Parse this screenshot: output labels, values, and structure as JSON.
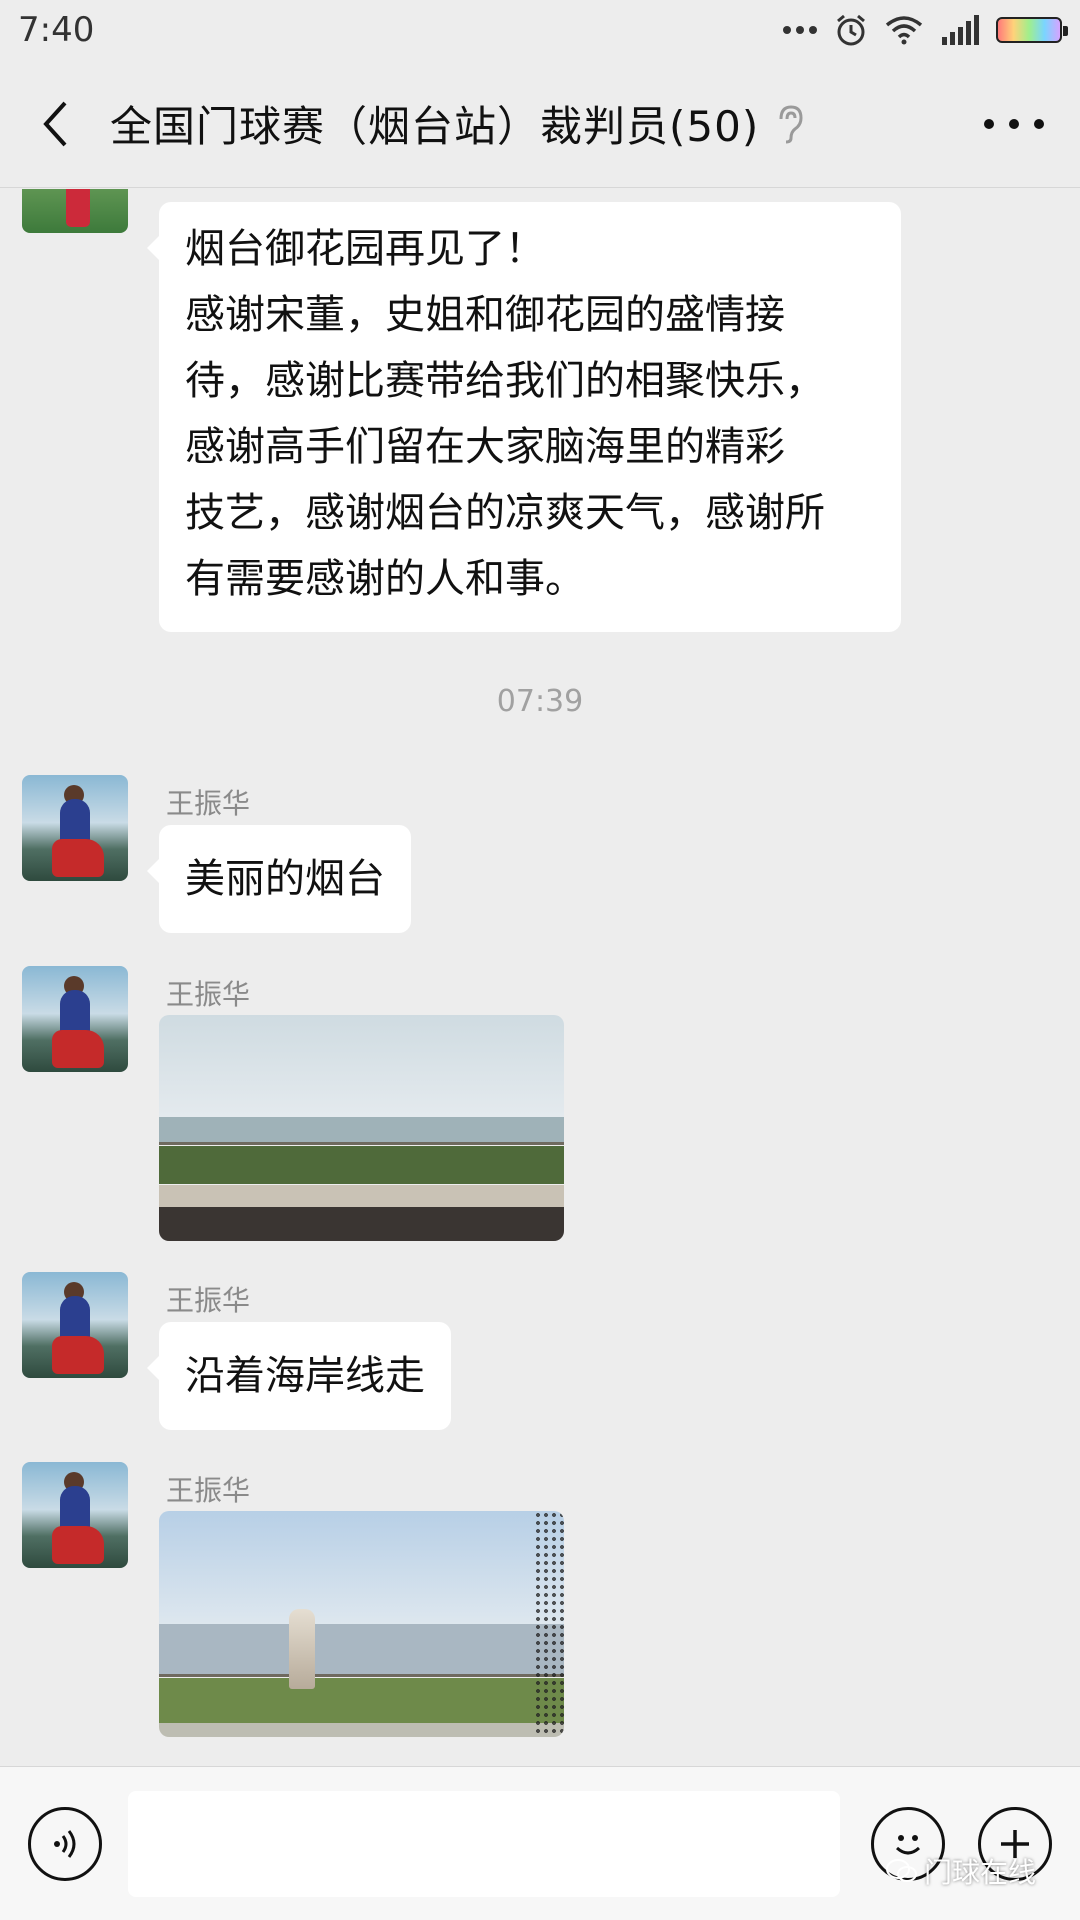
{
  "status_bar": {
    "time": "7:40",
    "icons": [
      "more-dots-icon",
      "alarm-icon",
      "wifi-icon",
      "signal-icon",
      "battery-icon"
    ]
  },
  "header": {
    "title": "全国门球赛（烟台站）裁判员(50)",
    "back_icon": "chevron-left-icon",
    "ear_icon": "ear-icon",
    "more_icon": "more-horizontal-icon"
  },
  "messages": {
    "m1": {
      "lines": [
        "烟台御花园再见了！",
        "感谢宋董，史姐和御花园的盛情接",
        "待，感谢比赛带给我们的相聚快乐，",
        "感谢高手们留在大家脑海里的精彩",
        "技艺，感谢烟台的凉爽天气，感谢所",
        "有需要感谢的人和事。"
      ]
    },
    "timestamp": "07:39",
    "m2": {
      "sender": "王振华",
      "text": "美丽的烟台"
    },
    "m3": {
      "sender": "王振华",
      "image": "seaside-promenade-photo"
    },
    "m4": {
      "sender": "王振华",
      "text": "沿着海岸线走"
    },
    "m5": {
      "sender": "王振华",
      "image": "coastline-monument-photo"
    }
  },
  "input_bar": {
    "voice_icon": "voice-icon",
    "input_value": "",
    "emoji_icon": "emoji-icon",
    "plus_icon": "plus-icon",
    "watermark": "门球在线"
  },
  "colors": {
    "background": "#ededed",
    "bubble": "#ffffff",
    "meta_text": "#8a8a8a"
  }
}
